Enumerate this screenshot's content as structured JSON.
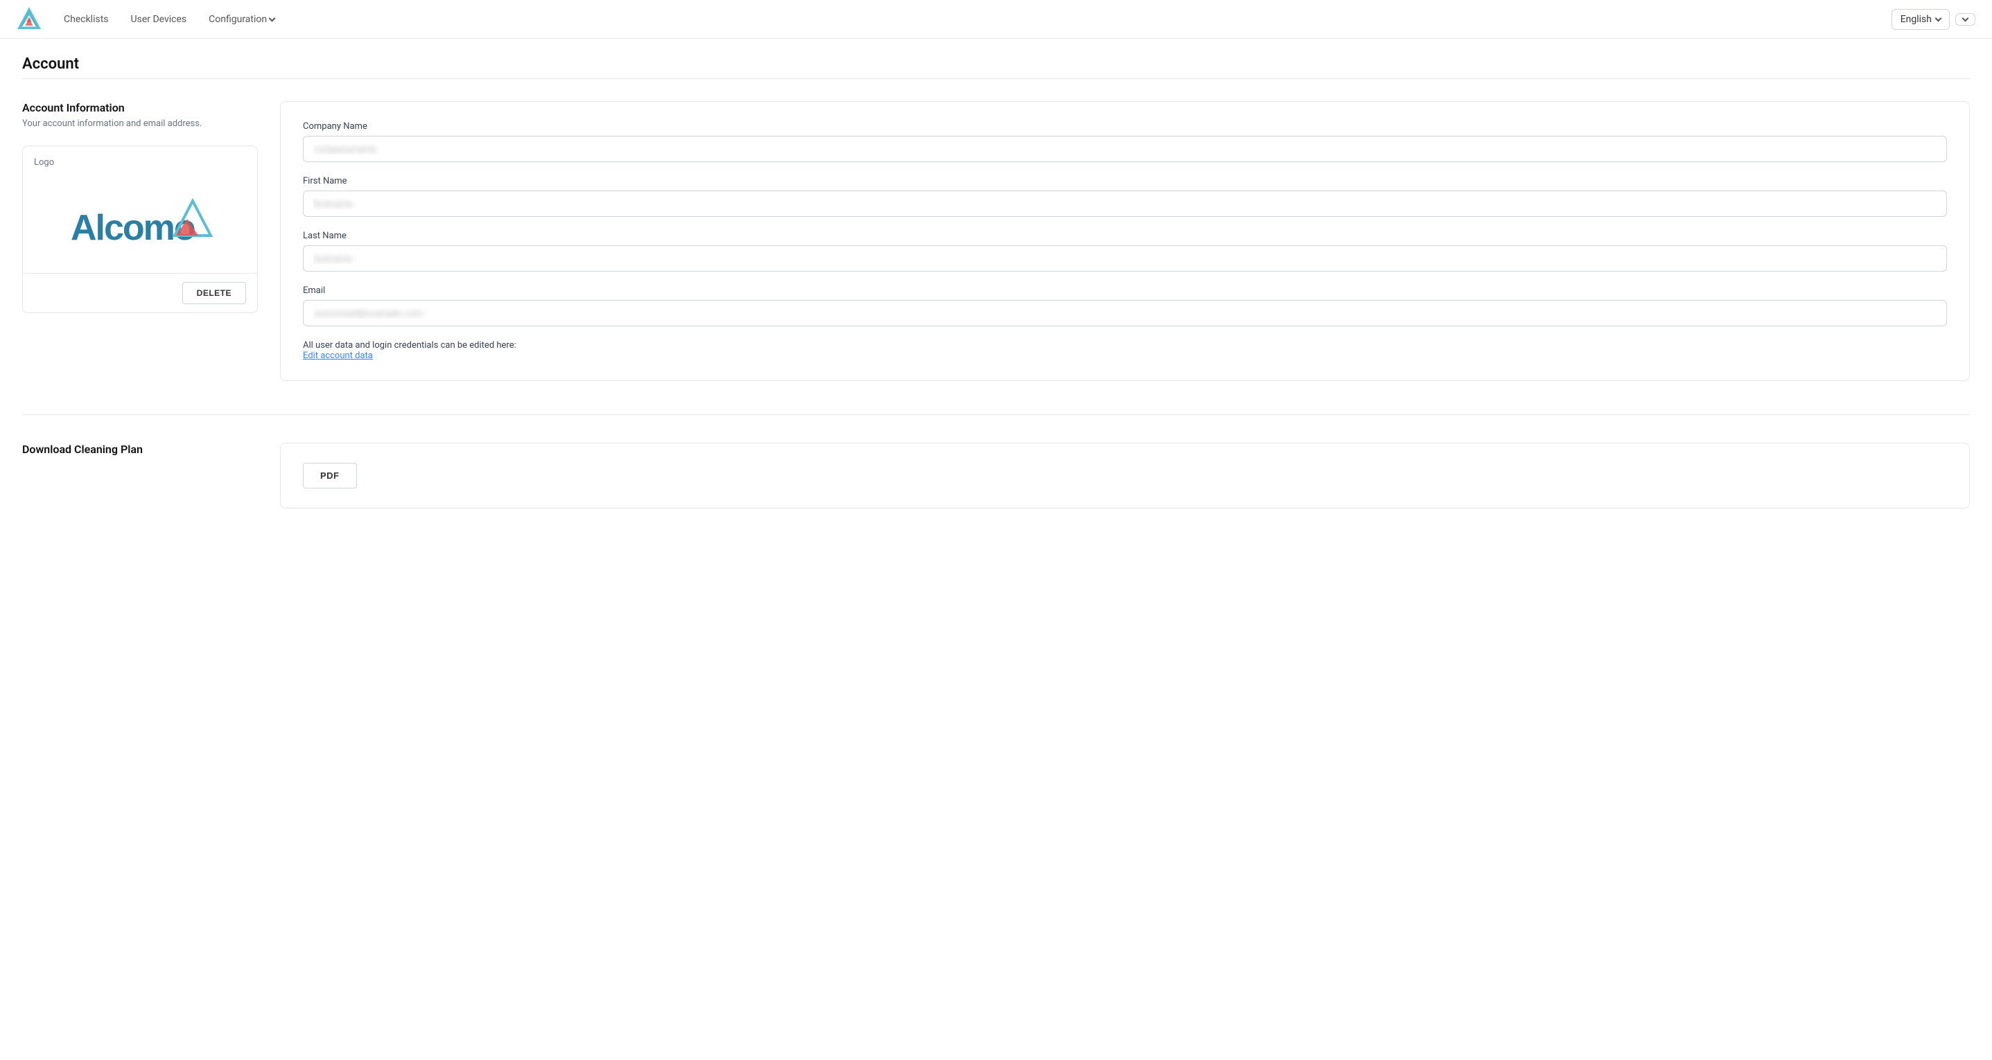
{
  "navbar": {
    "logo_alt": "Alcomo logo",
    "links": [
      {
        "id": "checklists",
        "label": "Checklists"
      },
      {
        "id": "user-devices",
        "label": "User Devices"
      },
      {
        "id": "configuration",
        "label": "Configuration",
        "has_dropdown": true
      }
    ],
    "language": "English",
    "user_dropdown_aria": "User menu"
  },
  "page": {
    "title": "Account"
  },
  "account_info": {
    "section_title": "Account Information",
    "section_subtitle": "Your account information and email address.",
    "logo_label": "Logo",
    "delete_button": "DELETE",
    "fields": {
      "company_name": {
        "label": "Company Name",
        "value": "●●●●●●●●●●●●●●●●"
      },
      "first_name": {
        "label": "First Name",
        "value": "●●●●●●●●●●"
      },
      "last_name": {
        "label": "Last Name",
        "value": "●●●●●●●●●●"
      },
      "email": {
        "label": "Email",
        "value": "●●●●●●●●●●●●●●●●●●"
      }
    },
    "edit_note": "All user data and login credentials can be edited here:",
    "edit_link": "Edit account data"
  },
  "download_cleaning_plan": {
    "section_title": "Download Cleaning Plan",
    "pdf_button": "PDF"
  }
}
